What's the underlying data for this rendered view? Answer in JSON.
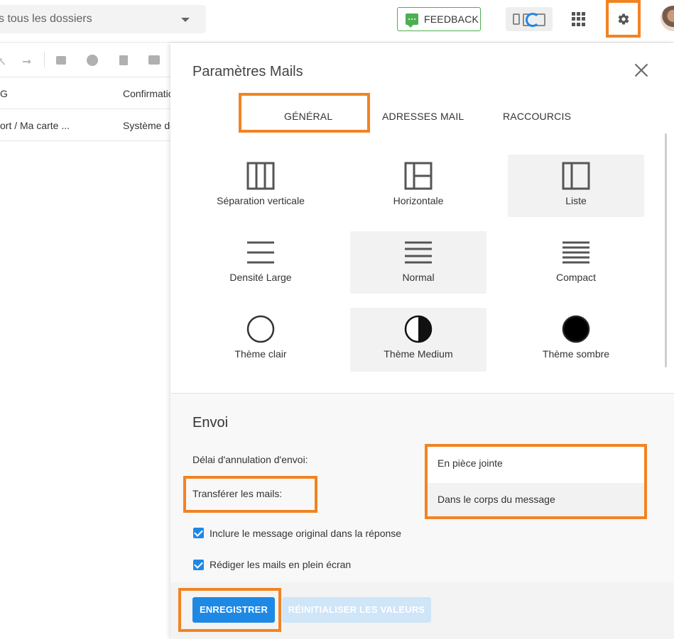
{
  "search": {
    "text": "s tous les dossiers"
  },
  "header": {
    "feedback_label": "FEEDBACK"
  },
  "mail_list": {
    "rows": [
      {
        "col1": "G",
        "col2": "Confirmatio"
      },
      {
        "col1": "ort / Ma carte ...",
        "col2": "Système de"
      }
    ]
  },
  "settings": {
    "title": "Paramètres Mails",
    "tabs": [
      "GÉNÉRAL",
      "ADRESSES MAIL",
      "RACCOURCIS"
    ],
    "layout_options": [
      "Séparation verticale",
      "Horizontale",
      "Liste"
    ],
    "density_options": [
      "Densité Large",
      "Normal",
      "Compact"
    ],
    "theme_options": [
      "Thème clair",
      "Thème Medium",
      "Thème sombre"
    ],
    "selected": {
      "layout": "Liste",
      "density": "Normal",
      "theme": "Thème Medium"
    },
    "envoi": {
      "heading": "Envoi",
      "cancel_delay_label": "Délai d'annulation d'envoi:",
      "forward_label": "Transférer les mails:",
      "forward_options": [
        "En pièce jointe",
        "Dans le corps du message"
      ],
      "include_original_label": "Inclure le message original dans la réponse",
      "fullscreen_label": "Rédiger les mails en plein écran"
    },
    "buttons": {
      "save": "ENREGISTRER",
      "reset": "RÉINITIALISER LES VALEURS"
    }
  },
  "colors": {
    "accent": "#1e88e5",
    "highlight": "#f28322",
    "feedback": "#4caf50"
  },
  "icons": [
    "search-caret-icon",
    "feedback-icon",
    "device-sync-icon",
    "apps-grid-icon",
    "gear-icon",
    "close-icon",
    "checkbox-checked-icon"
  ]
}
